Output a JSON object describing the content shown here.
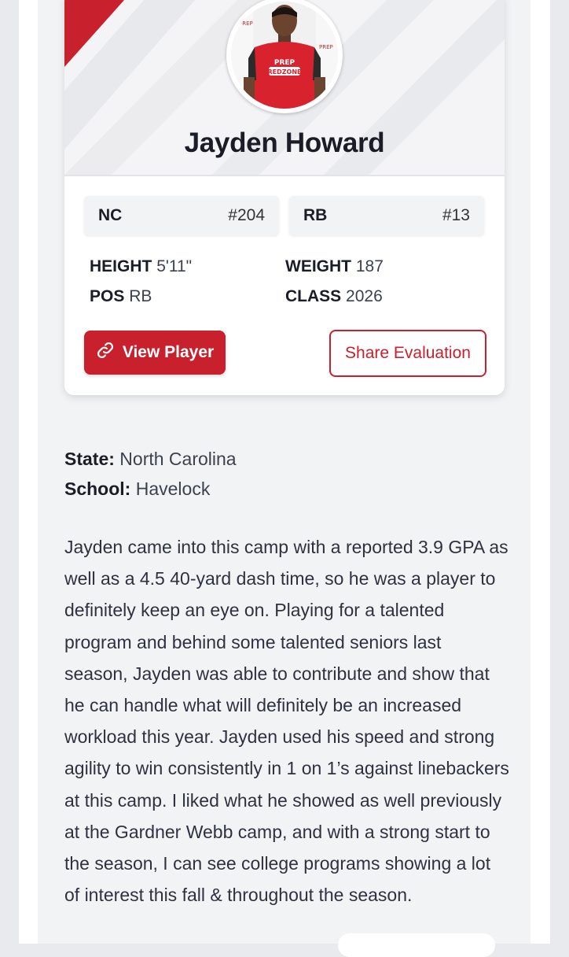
{
  "player": {
    "name": "Jayden Howard",
    "avatar_shirt_text": [
      "PREP",
      "REDZONE"
    ],
    "state_chip": {
      "label": "NC",
      "rank": "#204"
    },
    "position_chip": {
      "label": "RB",
      "rank": "#13"
    },
    "stats": {
      "height": {
        "key": "HEIGHT",
        "value": "5'11\""
      },
      "weight": {
        "key": "WEIGHT",
        "value": "187"
      },
      "pos": {
        "key": "POS",
        "value": "RB"
      },
      "class": {
        "key": "CLASS",
        "value": "2026"
      }
    },
    "actions": {
      "view_player": "View Player",
      "share_evaluation": "Share Evaluation"
    }
  },
  "details": {
    "state_label": "State:",
    "state_value": "North Carolina",
    "school_label": "School:",
    "school_value": "Havelock"
  },
  "evaluation": "Jayden came into this camp with a reported 3.9 GPA as well as a 4.5 40-yard dash time, so he was a player to definitely keep an eye on. Playing for a talented program and behind some talented seniors last season, Jayden was able to contribute and show that he can handle what will definitely be an increased workload this year. Jayden used his speed and strong agility to win consistently in 1 on 1’s against linebackers at this camp. I liked what he showed as well previously at the Gardner Webb camp, and with a strong start to the season, I can see college programs showing a lot of interest this fall & throughout the season.",
  "colors": {
    "accent": "#c8202c",
    "text": "#1a1d27",
    "panel": "#f2f3f5"
  },
  "icons": {
    "view_player": "link-icon"
  }
}
